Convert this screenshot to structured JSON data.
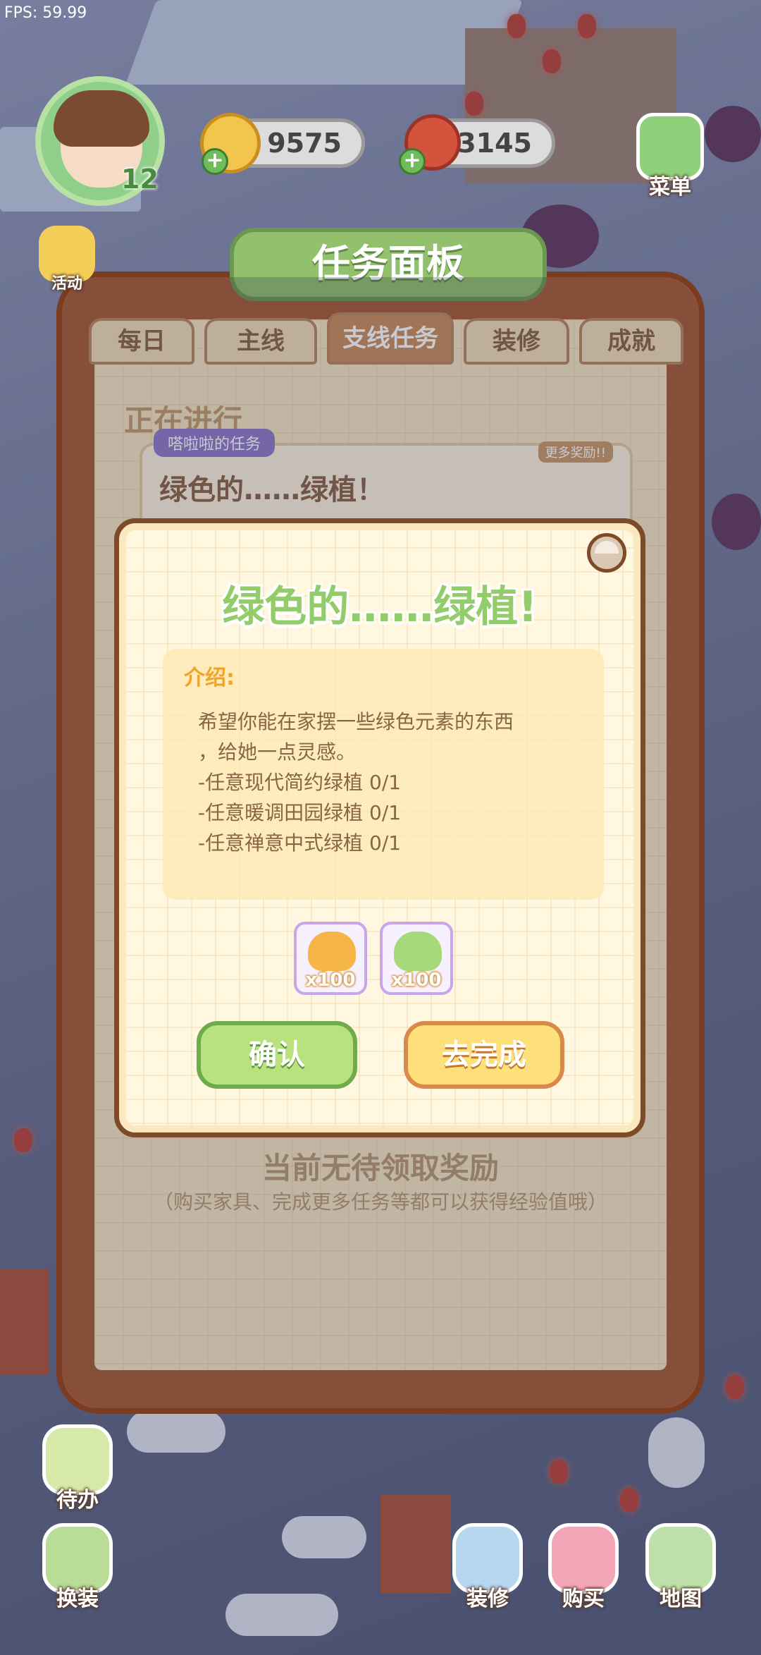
{
  "fps": "FPS: 59.99",
  "player": {
    "level": "12"
  },
  "resources": {
    "coins": "9575",
    "cherries": "3145"
  },
  "side_buttons": {
    "activity": "活动",
    "menu": "菜单"
  },
  "board": {
    "title": "任务面板",
    "tabs": [
      "每日",
      "主线",
      "支线任务",
      "装修",
      "成就"
    ],
    "active_tab": "支线任务",
    "section": "正在进行",
    "task_owner": "嗒啦啦的任务",
    "task_name": "绿色的……绿植！",
    "more_rewards": "更多奖励!!",
    "no_reward": "当前无待领取奖励",
    "hint": "（购买家具、完成更多任务等都可以获得经验值哦）"
  },
  "modal": {
    "title": "绿色的……绿植!",
    "intro_heading": "介绍:",
    "lines": [
      "希望你能在家摆一些绿色元素的东西",
      "，给她一点灵感。",
      "-任意现代简约绿植 0/1",
      "-任意暖调田园绿植 0/1",
      "-任意禅意中式绿植 0/1"
    ],
    "rewards": [
      {
        "icon": "coin-pile-icon",
        "count": "x100"
      },
      {
        "icon": "exp-plant-icon",
        "count": "x100"
      }
    ],
    "confirm_label": "确认",
    "go_label": "去完成"
  },
  "bottom_nav": {
    "todo": "待办",
    "dress": "换装",
    "decorate": "装修",
    "shop": "购买",
    "map": "地图"
  },
  "colors": {
    "board_wood": "#a55c35",
    "title_green": "#93cc6a",
    "confirm_green": "#b7e27d",
    "go_yellow": "#fde07a"
  }
}
